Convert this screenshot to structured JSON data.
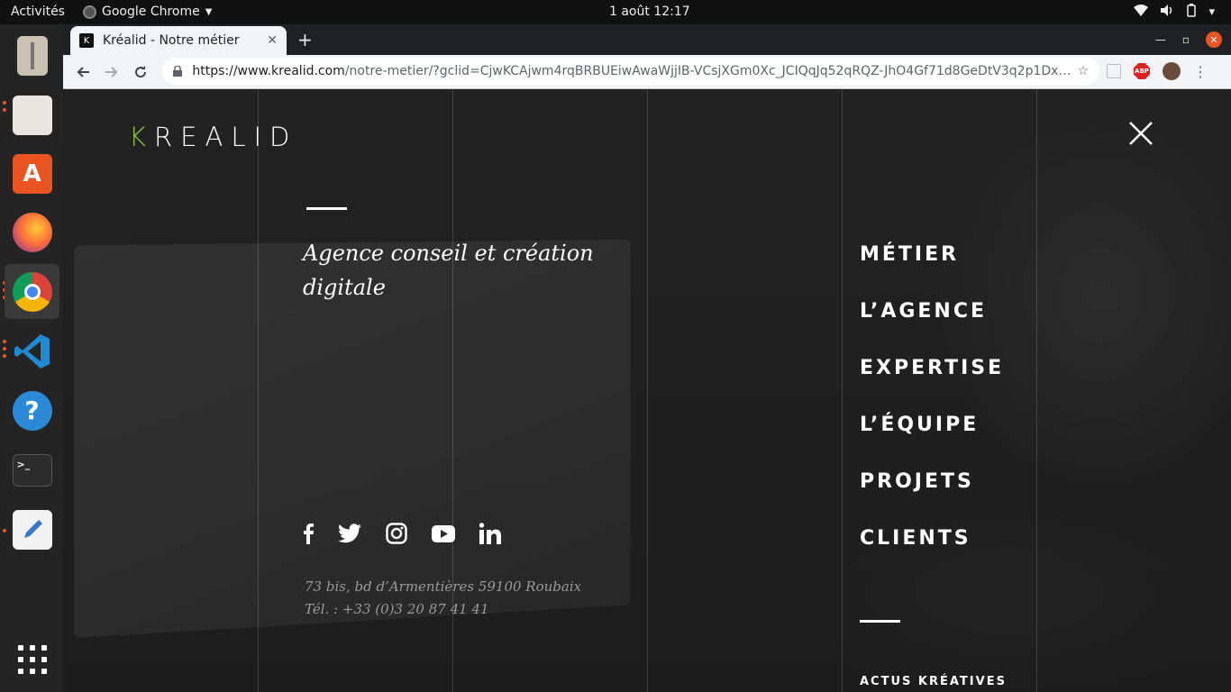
{
  "topbar": {
    "activities": "Activités",
    "app_name": "Google Chrome",
    "clock": "1 août  12:17"
  },
  "dock": {
    "items": [
      "archive-manager",
      "files",
      "ubuntu-software",
      "firefox",
      "google-chrome",
      "vscode",
      "help",
      "terminal",
      "text-editor",
      "show-applications"
    ]
  },
  "browser": {
    "tab_title": "Kréalid - Notre métier",
    "url_host": "https://www.krealid.com",
    "url_rest": "/notre-metier/?gclid=CjwKCAjwm4rqBRBUEiwAwaWjjIB-VCsjXGm0Xc_JCIQqJq52qRQZ-JhO4Gf71d8GeDtV3q2p1Dx5vRoC9...",
    "abp_label": "ABP"
  },
  "site": {
    "logo_accent": "K",
    "logo_rest": "REALID",
    "tagline": "Agence conseil et création digitale",
    "address_line1": "73 bis, bd d’Armentières 59100 Roubaix",
    "address_line2": "Tél. : +33 (0)3 20 87 41 41",
    "nav": [
      "MÉTIER",
      "L’AGENCE",
      "EXPERTISE",
      "L’ÉQUIPE",
      "PROJETS",
      "CLIENTS"
    ],
    "actus": "ACTUS KRÉATIVES",
    "social": [
      "facebook",
      "twitter",
      "instagram",
      "youtube",
      "linkedin"
    ]
  },
  "colors": {
    "logo_accent": "#8cc63f",
    "ubuntu_orange": "#e95420"
  }
}
